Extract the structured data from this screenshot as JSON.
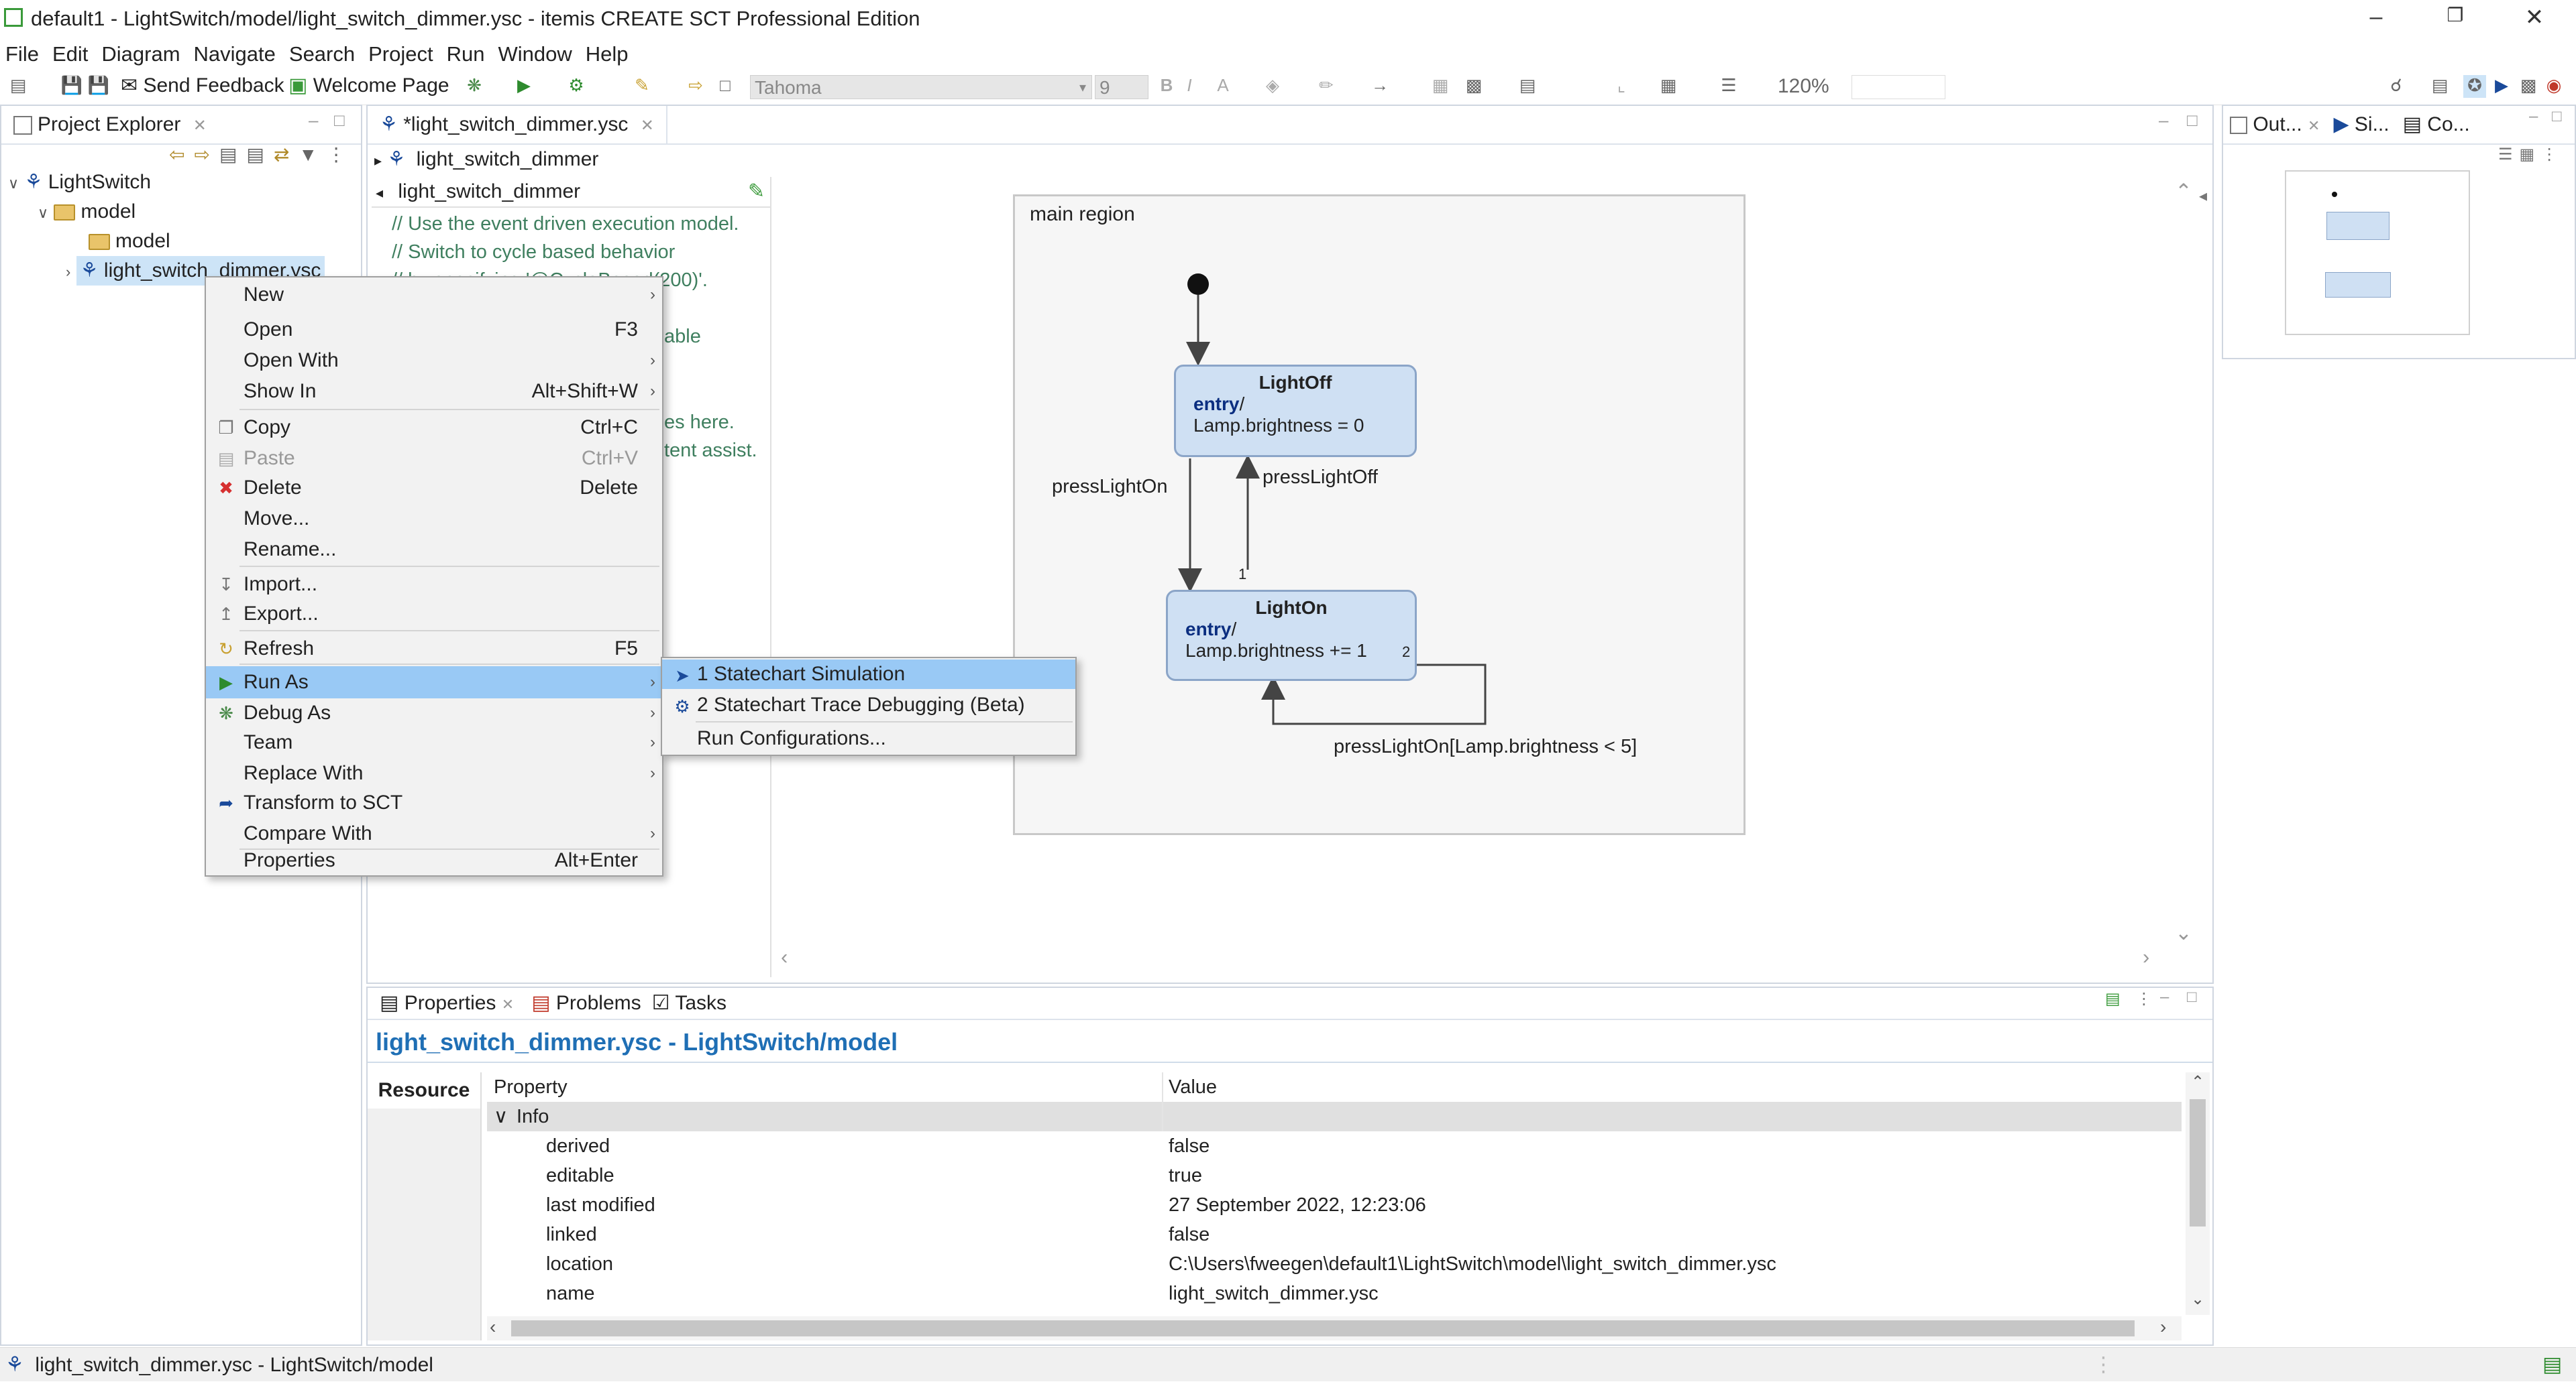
{
  "window": {
    "title": "default1 - LightSwitch/model/light_switch_dimmer.ysc - itemis CREATE SCT Professional Edition"
  },
  "menubar": [
    "File",
    "Edit",
    "Diagram",
    "Navigate",
    "Search",
    "Project",
    "Run",
    "Window",
    "Help"
  ],
  "toolbar": {
    "send_feedback": "Send Feedback",
    "welcome_page": "Welcome Page",
    "font_name": "Tahoma",
    "font_size": "9",
    "zoom": "120%"
  },
  "project_explorer": {
    "tab": "Project Explorer",
    "items": [
      "LightSwitch",
      "model",
      "model",
      "light_switch_dimmer.ysc"
    ]
  },
  "editor": {
    "tab": "*light_switch_dimmer.ysc",
    "breadcrumb": "light_switch_dimmer",
    "definition_title": "light_switch_dimmer",
    "comments": [
      "// Use the event driven execution model.",
      "// Switch to cycle based behavior",
      "// by specifying '@CycleBased(200)'.",
      "able",
      "es here.",
      "tent assist."
    ],
    "region_label": "main region",
    "states": {
      "off": {
        "name": "LightOff",
        "entry_kw": "entry",
        "action": "Lamp.brightness = 0"
      },
      "on": {
        "name": "LightOn",
        "entry_kw": "entry",
        "action": "Lamp.brightness += 1"
      }
    },
    "transitions": {
      "press_on": "pressLightOn",
      "press_off": "pressLightOff",
      "self_loop": "pressLightOn[Lamp.brightness < 5]",
      "priority_1": "1",
      "priority_2": "2"
    }
  },
  "right_tabs": [
    "Out...",
    "Si...",
    "Co..."
  ],
  "context_menu": {
    "items": [
      {
        "label": "New",
        "shortcut": "",
        "submenu": true
      },
      {
        "label": "Open",
        "shortcut": "F3",
        "submenu": false
      },
      {
        "label": "Open With",
        "shortcut": "",
        "submenu": true
      },
      {
        "label": "Show In",
        "shortcut": "Alt+Shift+W",
        "submenu": true
      },
      {
        "label": "Copy",
        "shortcut": "Ctrl+C",
        "submenu": false
      },
      {
        "label": "Paste",
        "shortcut": "Ctrl+V",
        "submenu": false
      },
      {
        "label": "Delete",
        "shortcut": "Delete",
        "submenu": false
      },
      {
        "label": "Move...",
        "shortcut": "",
        "submenu": false
      },
      {
        "label": "Rename...",
        "shortcut": "",
        "submenu": false
      },
      {
        "label": "Import...",
        "shortcut": "",
        "submenu": false
      },
      {
        "label": "Export...",
        "shortcut": "",
        "submenu": false
      },
      {
        "label": "Refresh",
        "shortcut": "F5",
        "submenu": false
      },
      {
        "label": "Run As",
        "shortcut": "",
        "submenu": true
      },
      {
        "label": "Debug As",
        "shortcut": "",
        "submenu": true
      },
      {
        "label": "Team",
        "shortcut": "",
        "submenu": true
      },
      {
        "label": "Replace With",
        "shortcut": "",
        "submenu": true
      },
      {
        "label": "Transform to SCT",
        "shortcut": "",
        "submenu": false
      },
      {
        "label": "Compare With",
        "shortcut": "",
        "submenu": true
      },
      {
        "label": "Properties",
        "shortcut": "Alt+Enter",
        "submenu": false
      }
    ]
  },
  "run_as_submenu": [
    "1 Statechart Simulation",
    "2 Statechart Trace Debugging (Beta)",
    "Run Configurations..."
  ],
  "bottom": {
    "tabs": [
      "Properties",
      "Problems",
      "Tasks"
    ],
    "title": "light_switch_dimmer.ysc - LightSwitch/model",
    "side_tab": "Resource",
    "col_property": "Property",
    "col_value": "Value",
    "group": "Info",
    "rows": [
      {
        "p": "derived",
        "v": "false"
      },
      {
        "p": "editable",
        "v": "true"
      },
      {
        "p": "last modified",
        "v": "27 September 2022, 12:23:06"
      },
      {
        "p": "linked",
        "v": "false"
      },
      {
        "p": "location",
        "v": "C:\\Users\\fweegen\\default1\\LightSwitch\\model\\light_switch_dimmer.ysc"
      },
      {
        "p": "name",
        "v": "light_switch_dimmer.ysc"
      }
    ]
  },
  "status": "light_switch_dimmer.ysc - LightSwitch/model",
  "colors": {
    "accent": "#99c9f5",
    "state_fill": "#cfe0f3",
    "title_blue": "#1f6fb5"
  }
}
